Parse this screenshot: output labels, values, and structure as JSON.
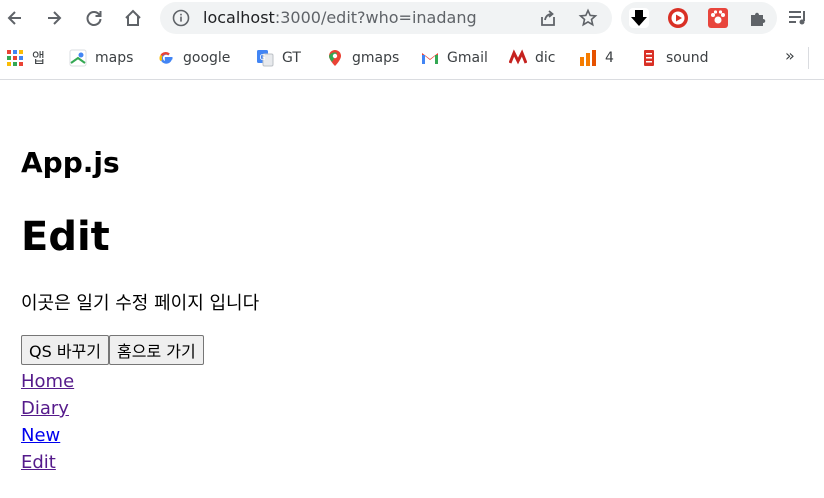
{
  "browser": {
    "url": {
      "host": "localhost",
      "path": ":3000/edit?who=inadang"
    },
    "bookmarks": [
      {
        "label": "앱",
        "icon": "apps-grid-icon"
      },
      {
        "label": "maps",
        "icon": "maps-icon"
      },
      {
        "label": "google",
        "icon": "google-icon"
      },
      {
        "label": "GT",
        "icon": "translate-icon"
      },
      {
        "label": "gmaps",
        "icon": "gmaps-pin-icon"
      },
      {
        "label": "Gmail",
        "icon": "gmail-icon"
      },
      {
        "label": "dic",
        "icon": "dictionary-icon"
      },
      {
        "label": "4",
        "icon": "bars-icon"
      },
      {
        "label": "sound",
        "icon": "sound-icon"
      }
    ],
    "more_label": "»"
  },
  "page": {
    "app_title": "App.js",
    "heading": "Edit",
    "description": "이곳은 일기 수정 페이지 입니다",
    "buttons": {
      "change_qs": "QS 바꾸기",
      "go_home": "홈으로 가기"
    },
    "links": [
      {
        "label": "Home",
        "visited": true
      },
      {
        "label": "Diary",
        "visited": true
      },
      {
        "label": "New",
        "visited": false
      },
      {
        "label": "Edit",
        "visited": true
      }
    ]
  }
}
